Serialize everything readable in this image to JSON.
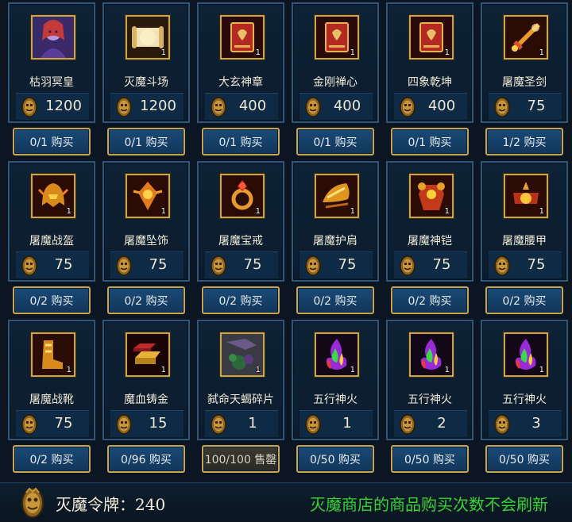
{
  "items": [
    {
      "name": "枯羽冥皇",
      "qty": "",
      "price": "1200",
      "button": "0/1 购买",
      "sold": false,
      "icon": "portrait-icon"
    },
    {
      "name": "灭魔斗场",
      "qty": "1",
      "price": "1200",
      "button": "0/1 购买",
      "sold": false,
      "icon": "scroll-icon"
    },
    {
      "name": "大玄神章",
      "qty": "1",
      "price": "400",
      "button": "0/1 购买",
      "sold": false,
      "icon": "book-icon"
    },
    {
      "name": "金刚禅心",
      "qty": "1",
      "price": "400",
      "button": "0/1 购买",
      "sold": false,
      "icon": "book-icon"
    },
    {
      "name": "四象乾坤",
      "qty": "1",
      "price": "400",
      "button": "0/1 购买",
      "sold": false,
      "icon": "book-icon"
    },
    {
      "name": "屠魔圣剑",
      "qty": "1",
      "price": "75",
      "button": "1/2 购买",
      "sold": false,
      "icon": "sword-icon"
    },
    {
      "name": "屠魔战盔",
      "qty": "1",
      "price": "75",
      "button": "0/2 购买",
      "sold": false,
      "icon": "helmet-icon"
    },
    {
      "name": "屠魔坠饰",
      "qty": "1",
      "price": "75",
      "button": "0/2 购买",
      "sold": false,
      "icon": "pendant-icon"
    },
    {
      "name": "屠魔宝戒",
      "qty": "1",
      "price": "75",
      "button": "0/2 购买",
      "sold": false,
      "icon": "ring-icon"
    },
    {
      "name": "屠魔护肩",
      "qty": "1",
      "price": "75",
      "button": "0/2 购买",
      "sold": false,
      "icon": "shoulder-icon"
    },
    {
      "name": "屠魔神铠",
      "qty": "1",
      "price": "75",
      "button": "0/2 购买",
      "sold": false,
      "icon": "armor-icon"
    },
    {
      "name": "屠魔腰甲",
      "qty": "1",
      "price": "75",
      "button": "0/2 购买",
      "sold": false,
      "icon": "belt-icon"
    },
    {
      "name": "屠魔战靴",
      "qty": "1",
      "price": "75",
      "button": "0/2 购买",
      "sold": false,
      "icon": "boots-icon"
    },
    {
      "name": "魔血铸金",
      "qty": "1",
      "price": "15",
      "button": "0/96 购买",
      "sold": false,
      "icon": "gold-ingot-icon"
    },
    {
      "name": "弑命天蝎碎片",
      "qty": "1",
      "price": "1",
      "button": "100/100 售罄",
      "sold": true,
      "icon": "scorpion-fragment-icon"
    },
    {
      "name": "五行神火",
      "qty": "1",
      "price": "1",
      "button": "0/50 购买",
      "sold": false,
      "icon": "fire-icon"
    },
    {
      "name": "五行神火",
      "qty": "1",
      "price": "2",
      "button": "0/50 购买",
      "sold": false,
      "icon": "fire-icon"
    },
    {
      "name": "五行神火",
      "qty": "1",
      "price": "3",
      "button": "0/50 购买",
      "sold": false,
      "icon": "fire-icon"
    }
  ],
  "footer": {
    "currency_label": "灭魔令牌：240",
    "notice": "灭魔商店的商品购买次数不会刷新",
    "currency_icon": "demon-token-icon"
  },
  "colors": {
    "background": "#0b1622",
    "card_border": "#2d587c",
    "gold_border": "#c7a450",
    "notice_green": "#35d334"
  }
}
